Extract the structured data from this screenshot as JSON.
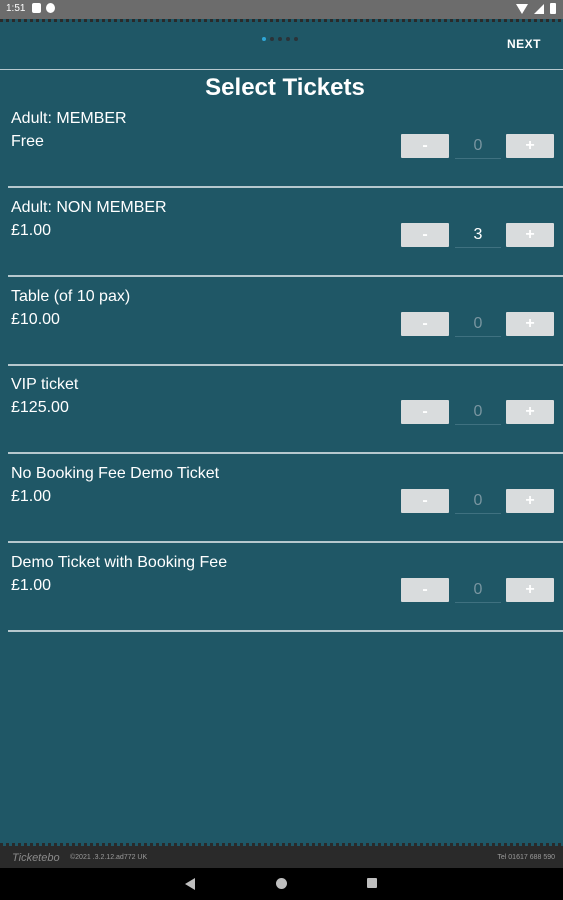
{
  "status_bar": {
    "time": "1:51",
    "icons_left": [
      "document-icon",
      "settings-icon"
    ],
    "icons_right": [
      "wifi-icon",
      "signal-icon",
      "battery-icon"
    ]
  },
  "header": {
    "pager_total": 5,
    "pager_active_index": 0,
    "next_label": "NEXT"
  },
  "page_title": "Select Tickets",
  "tickets": [
    {
      "name": "Adult: MEMBER",
      "price": "Free",
      "quantity": "0",
      "minus_label": "-",
      "plus_label": "+"
    },
    {
      "name": "Adult: NON MEMBER",
      "price": "£1.00",
      "quantity": "3",
      "minus_label": "-",
      "plus_label": "+"
    },
    {
      "name": "Table (of 10 pax)",
      "price": "£10.00",
      "quantity": "0",
      "minus_label": "-",
      "plus_label": "+"
    },
    {
      "name": "VIP ticket",
      "price": "£125.00",
      "quantity": "0",
      "minus_label": "-",
      "plus_label": "+"
    },
    {
      "name": "No Booking Fee Demo Ticket",
      "price": "£1.00",
      "quantity": "0",
      "minus_label": "-",
      "plus_label": "+"
    },
    {
      "name": "Demo Ticket with Booking Fee",
      "price": "£1.00",
      "quantity": "0",
      "minus_label": "-",
      "plus_label": "+"
    }
  ],
  "footer": {
    "logo": "Ticketebo",
    "version": "©2021 .3.2.12.ad772 UK",
    "tel": "Tel 01617 688 590"
  },
  "colors": {
    "background": "#1f5766",
    "button": "#d9dcdd",
    "pager_active": "#2fa6d6"
  }
}
